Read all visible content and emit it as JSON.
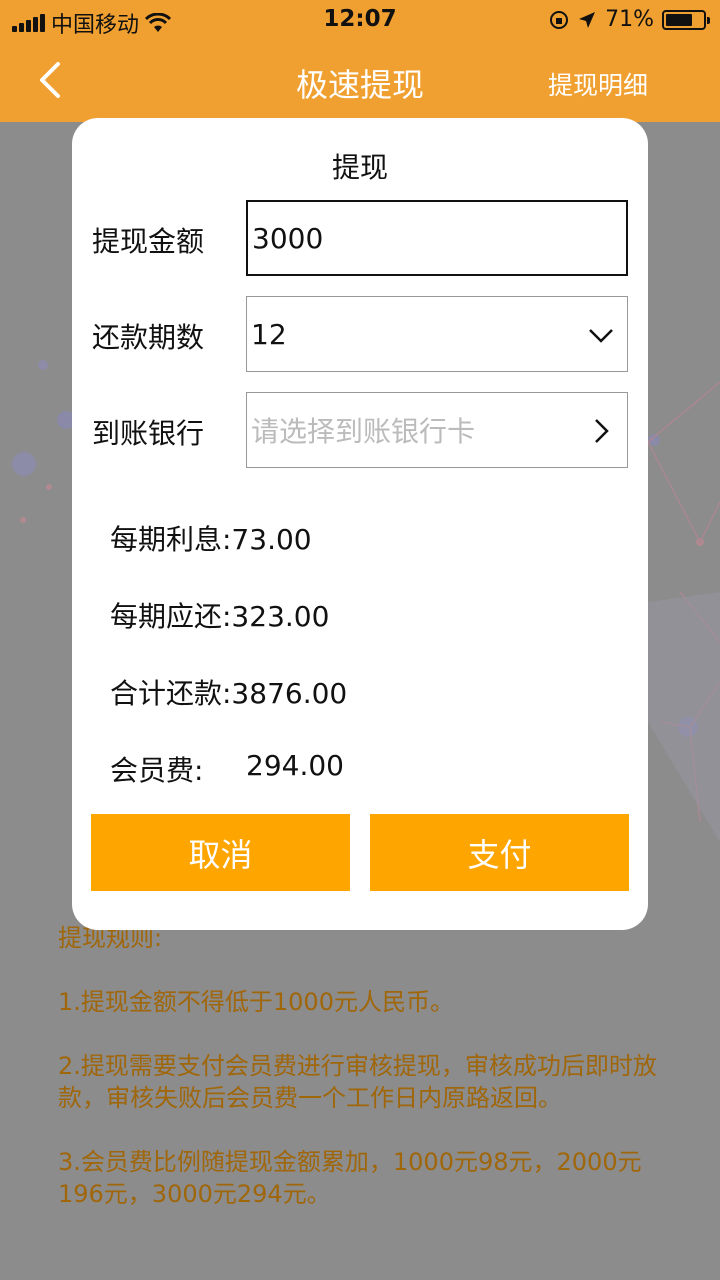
{
  "status": {
    "carrier": "中国移动",
    "time": "12:07",
    "battery": "71%",
    "battery_level": 0.71
  },
  "nav": {
    "title": "极速提现",
    "right_link": "提现明细"
  },
  "modal": {
    "title": "提现",
    "amount_label": "提现金额",
    "amount_value": "3000",
    "periods_label": "还款期数",
    "periods_value": "12",
    "bank_label": "到账银行",
    "bank_placeholder": "请选择到账银行卡",
    "interest": "每期利息:73.00",
    "per_period": "每期应还:323.00",
    "total": "合计还款:3876.00",
    "fee_label": "会员费:",
    "fee_value": "294.00",
    "cancel": "取消",
    "pay": "支付"
  },
  "rules": {
    "title": "提现规则:",
    "items": [
      "1.提现金额不得低于1000元人民币。",
      "2.提现需要支付会员费进行审核提现，审核成功后即时放款，审核失败后会员费一个工作日内原路返回。",
      "3.会员费比例随提现金额累加，1000元98元，2000元196元，3000元294元。"
    ]
  }
}
